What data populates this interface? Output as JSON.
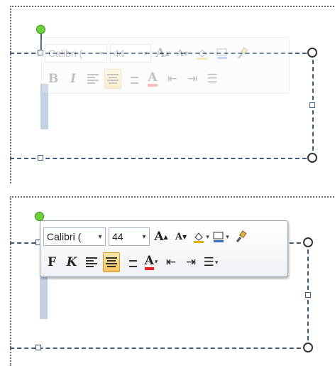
{
  "states": [
    {
      "name": "inactive",
      "toolbar": "faded"
    },
    {
      "name": "active",
      "toolbar": "active"
    }
  ],
  "mini_toolbar": {
    "font_name": "Calibri (",
    "font_size": "44",
    "bold_label": "B",
    "italic_label": "I",
    "bold_label_active": "F",
    "italic_label_active": "K",
    "grow_font": "A",
    "shrink_font": "A",
    "font_color_label": "A",
    "dropdown_arrow": "▾",
    "icons": [
      "grow-font-icon",
      "shrink-font-icon",
      "fill-color-icon",
      "line-color-icon",
      "format-painter-icon",
      "align-left-icon",
      "center-icon",
      "align-right-icon",
      "font-color-icon",
      "decrease-indent-icon",
      "increase-indent-icon",
      "bullets-icon"
    ]
  },
  "colors": {
    "selection_dash": "#3c5a7a",
    "rotation_handle": "#6ad13a",
    "highlight": "#f8c25c",
    "font_color_red": "#e02020"
  }
}
